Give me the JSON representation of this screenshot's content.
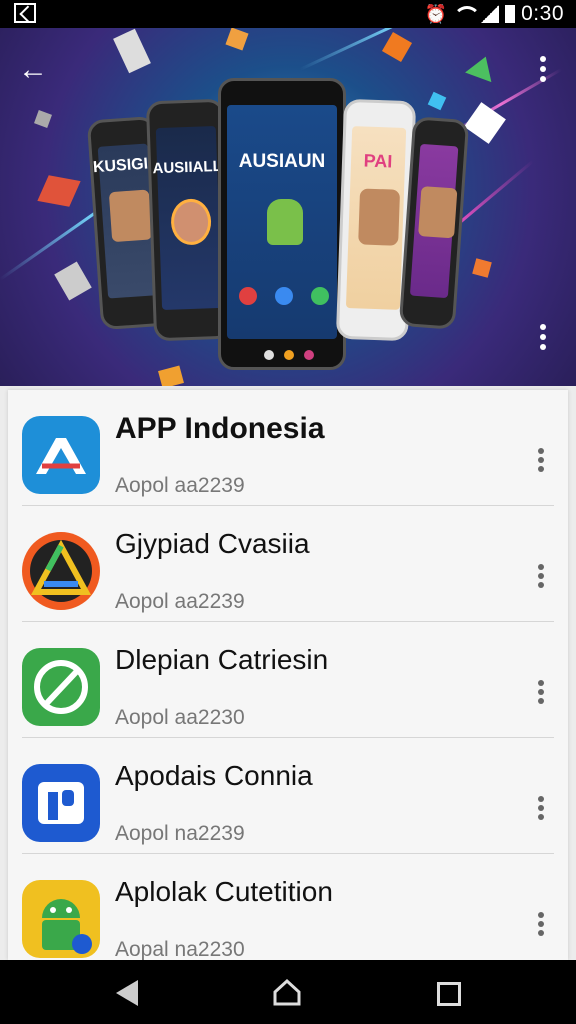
{
  "status_bar": {
    "time": "0:30",
    "icons": [
      "notification-icon",
      "alarm-icon",
      "wifi-icon",
      "signal-icon",
      "battery-icon"
    ]
  },
  "banner": {
    "back_icon": "back-arrow-icon",
    "menu_icon": "more-vert-icon",
    "phones": [
      {
        "title": "KUSIGIIN"
      },
      {
        "title": "AUSIIALL"
      },
      {
        "title": "AUSIAUN"
      },
      {
        "title": "PAI"
      },
      {
        "title": ""
      }
    ],
    "page_indicator": {
      "count": 3,
      "active": 1,
      "colors": [
        "#e0e0e0",
        "#f0a020",
        "#d04080"
      ]
    }
  },
  "apps": [
    {
      "name": "APP Indonesia",
      "subtitle": "Aopol aa2239",
      "icon": "blue-a-logo-icon",
      "bold": true
    },
    {
      "name": "Gjypiad Cvasiia",
      "subtitle": "Aopol aa2239",
      "icon": "triangle-logo-icon",
      "bold": false
    },
    {
      "name": "Dlepian Catriesin",
      "subtitle": "Aopol aa2230",
      "icon": "green-leaf-icon",
      "bold": false
    },
    {
      "name": "Apodais Connia",
      "subtitle": "Aopol na2239",
      "icon": "blue-p-logo-icon",
      "bold": false
    },
    {
      "name": "Aplolak Cutetition",
      "subtitle": "Aopal na2230",
      "icon": "android-icon",
      "bold": false
    }
  ],
  "nav_bar": {
    "back": "nav-back-icon",
    "home": "nav-home-icon",
    "recents": "nav-recents-icon"
  },
  "colors": {
    "list_bg": "#f6f6f6",
    "divider": "#d6d6d6",
    "banner_blue": "#1c4f8a",
    "banner_purple": "#3a2a7a"
  }
}
